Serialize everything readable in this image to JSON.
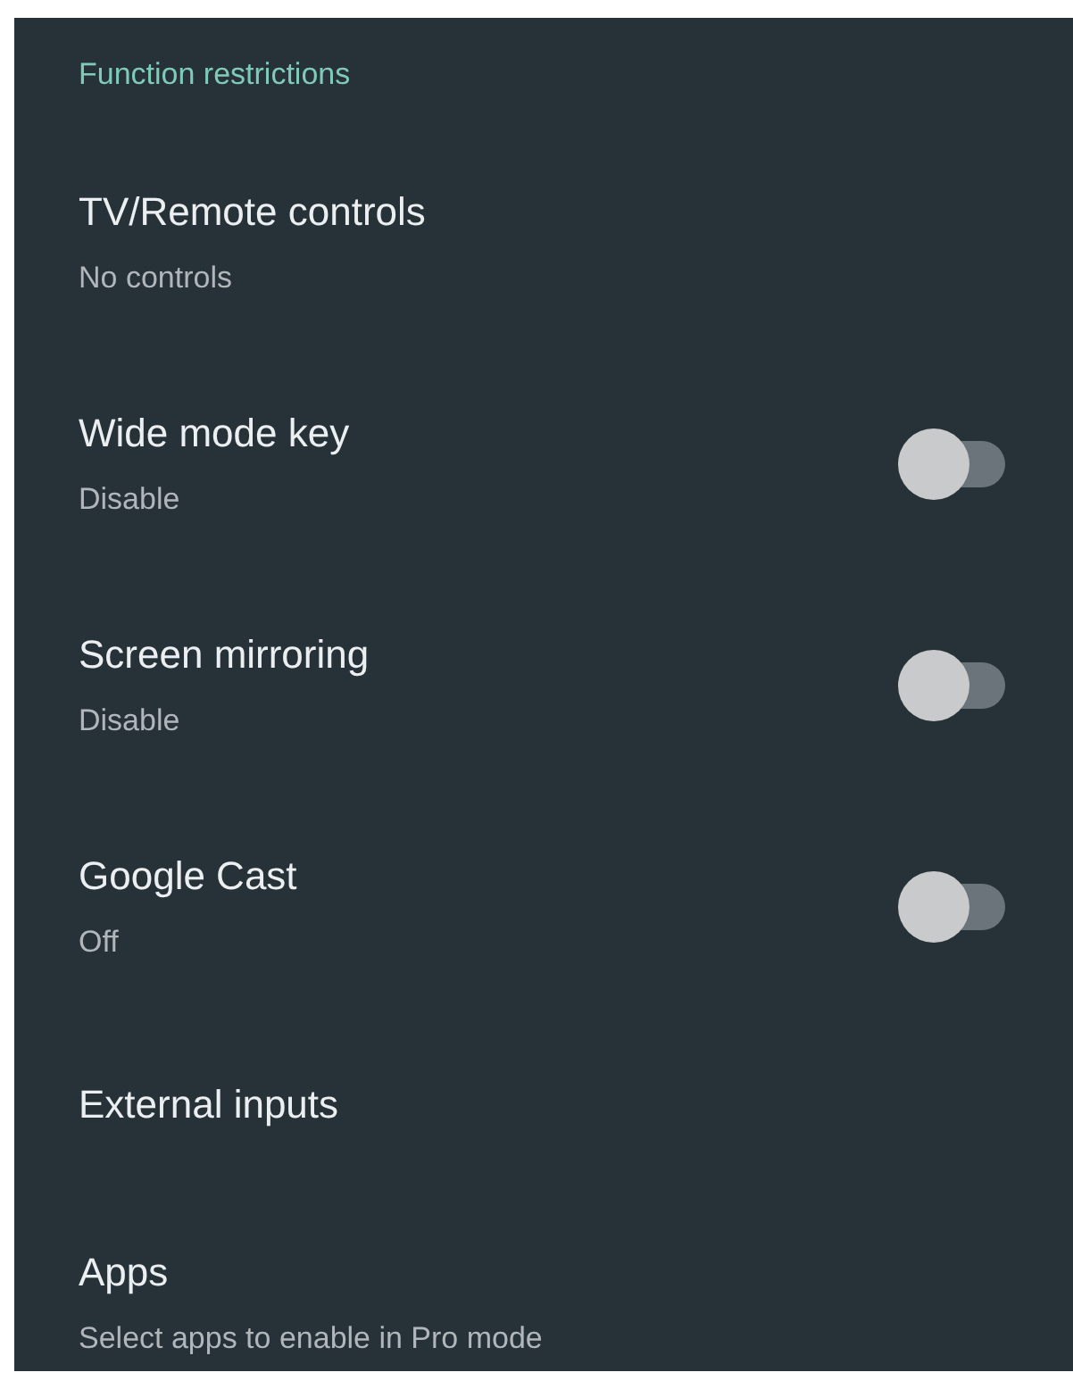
{
  "header": "Function restrictions",
  "items": [
    {
      "title": "TV/Remote controls",
      "summary": "No controls",
      "kind": "link"
    },
    {
      "title": "Wide mode key",
      "summary": "Disable",
      "kind": "switch",
      "on": false
    },
    {
      "title": "Screen mirroring",
      "summary": "Disable",
      "kind": "switch",
      "on": false
    },
    {
      "title": "Google Cast",
      "summary": "Off",
      "kind": "switch",
      "on": false
    },
    {
      "title": "External inputs",
      "kind": "link"
    },
    {
      "title": "Apps",
      "summary": "Select apps to enable in Pro mode",
      "kind": "link"
    }
  ]
}
